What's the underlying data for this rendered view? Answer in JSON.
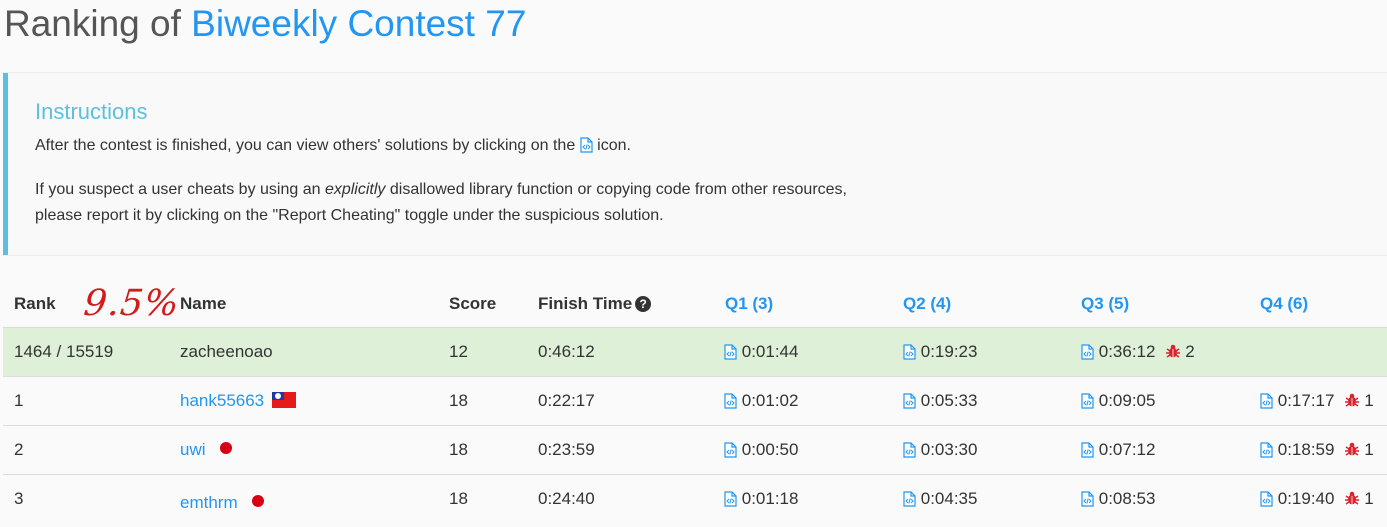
{
  "header": {
    "title_prefix": "Ranking of",
    "contest_name": "Biweekly Contest 77"
  },
  "instructions": {
    "heading": "Instructions",
    "line1_before_icon": "After the contest is finished, you can view others' solutions by clicking on the",
    "line1_after_icon": "icon.",
    "line2_before_em": "If you suspect a user cheats by using an",
    "line2_em": "explicitly",
    "line2_after_em": "disallowed library function or copying code from other resources,",
    "line3": "please report it by clicking on the \"Report Cheating\" toggle under the suspicious solution."
  },
  "annotation": "9.5%",
  "table": {
    "columns": {
      "rank": "Rank",
      "name": "Name",
      "score": "Score",
      "finish_time": "Finish Time",
      "q1": "Q1 (3)",
      "q2": "Q2 (4)",
      "q3": "Q3 (5)",
      "q4": "Q4 (6)"
    },
    "rows": [
      {
        "rank": "1464 / 15519",
        "name": "zacheenoao",
        "score": "12",
        "finish": "0:46:12",
        "q1": "0:01:44",
        "q2": "0:19:23",
        "q3": "0:36:12",
        "q3_bugs": "2",
        "q4": ""
      },
      {
        "rank": "1",
        "name": "hank55663",
        "flag": "taiwan-flag",
        "score": "18",
        "finish": "0:22:17",
        "q1": "0:01:02",
        "q2": "0:05:33",
        "q3": "0:09:05",
        "q4": "0:17:17",
        "q4_bugs": "1"
      },
      {
        "rank": "2",
        "name": "uwi",
        "flag": "japan-flag",
        "score": "18",
        "finish": "0:23:59",
        "q1": "0:00:50",
        "q2": "0:03:30",
        "q3": "0:07:12",
        "q4": "0:18:59",
        "q4_bugs": "1"
      },
      {
        "rank": "3",
        "name": "emthrm",
        "flag": "japan-flag",
        "score": "18",
        "finish": "0:24:40",
        "q1": "0:01:18",
        "q2": "0:04:35",
        "q3": "0:08:53",
        "q4": "0:19:40",
        "q4_bugs": "1"
      }
    ]
  },
  "colors": {
    "accent": "#2196f3",
    "info": "#5bc0de",
    "highlight_row": "#dff0d8",
    "bug": "#d9232e"
  }
}
